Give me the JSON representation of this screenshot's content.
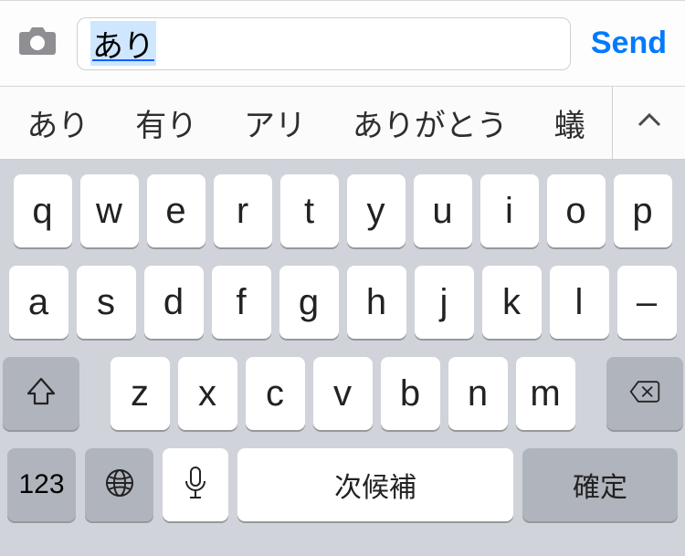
{
  "input_bar": {
    "composing_text": "あり",
    "send_label": "Send"
  },
  "candidates": [
    "あり",
    "有り",
    "アリ",
    "ありがとう",
    "蟻"
  ],
  "keyboard": {
    "row1": [
      "q",
      "w",
      "e",
      "r",
      "t",
      "y",
      "u",
      "i",
      "o",
      "p"
    ],
    "row2": [
      "a",
      "s",
      "d",
      "f",
      "g",
      "h",
      "j",
      "k",
      "l",
      "–"
    ],
    "row3": [
      "z",
      "x",
      "c",
      "v",
      "b",
      "n",
      "m"
    ],
    "switch_label": "123",
    "space_label": "次候補",
    "confirm_label": "確定"
  }
}
